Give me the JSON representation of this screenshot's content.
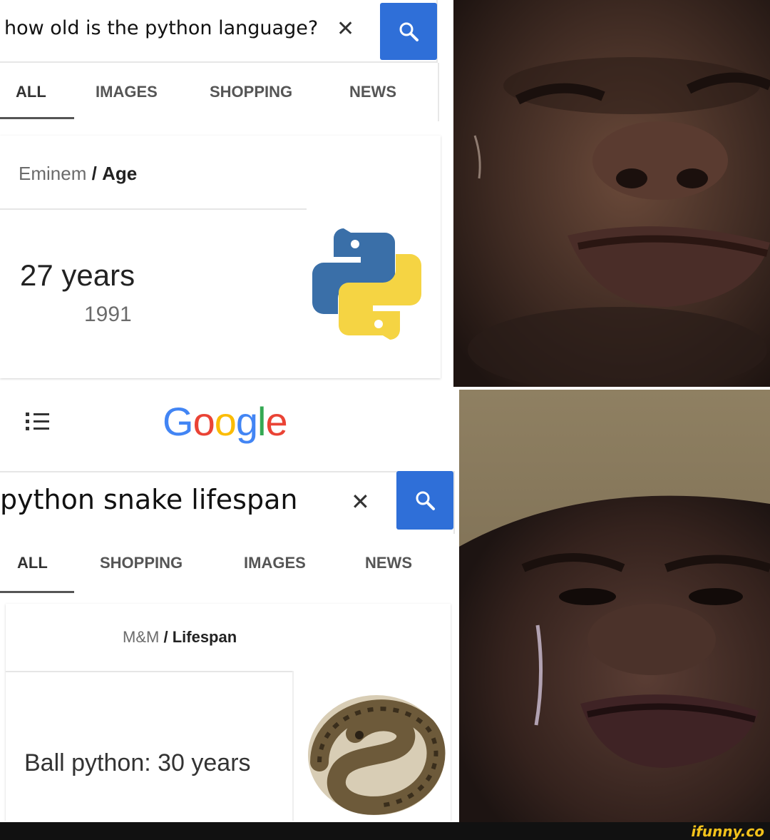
{
  "panel1": {
    "query": "how old is the python language?",
    "clear_icon": "close-icon",
    "search_icon": "search-icon",
    "tabs": [
      {
        "label": "ALL",
        "active": true
      },
      {
        "label": "IMAGES",
        "active": false
      },
      {
        "label": "SHOPPING",
        "active": false
      },
      {
        "label": "NEWS",
        "active": false
      }
    ],
    "breadcrumb": {
      "entity": "Eminem",
      "separator": "/",
      "attribute": "Age"
    },
    "answer": {
      "main": "27 years",
      "sub": "1991"
    },
    "result_image": "python-logo"
  },
  "google_bar": {
    "menu_icon": "apps-menu-icon",
    "logo_text": "Google",
    "logo_letters": [
      {
        "ch": "G",
        "color": "#4285F4"
      },
      {
        "ch": "o",
        "color": "#EA4335"
      },
      {
        "ch": "o",
        "color": "#FBBC05"
      },
      {
        "ch": "g",
        "color": "#4285F4"
      },
      {
        "ch": "l",
        "color": "#34A853"
      },
      {
        "ch": "e",
        "color": "#EA4335"
      }
    ]
  },
  "panel2": {
    "query": "python snake lifespan",
    "clear_icon": "close-icon",
    "search_icon": "search-icon",
    "tabs": [
      {
        "label": "ALL",
        "active": true
      },
      {
        "label": "SHOPPING",
        "active": false
      },
      {
        "label": "IMAGES",
        "active": false
      },
      {
        "label": "NEWS",
        "active": false
      }
    ],
    "breadcrumb": {
      "entity": "M&M",
      "separator": "/",
      "attribute": "Lifespan"
    },
    "answer": {
      "main": "Ball python: 30 years"
    },
    "result_image": "ball-python-photo"
  },
  "photos": [
    {
      "name": "crying-man-smiling-photo"
    },
    {
      "name": "crying-man-sad-photo"
    }
  ],
  "watermark": "ifunny.co",
  "colors": {
    "search_button": "#2f6fd8",
    "python_blue": "#3a6fa8",
    "python_yellow": "#f5d443"
  }
}
